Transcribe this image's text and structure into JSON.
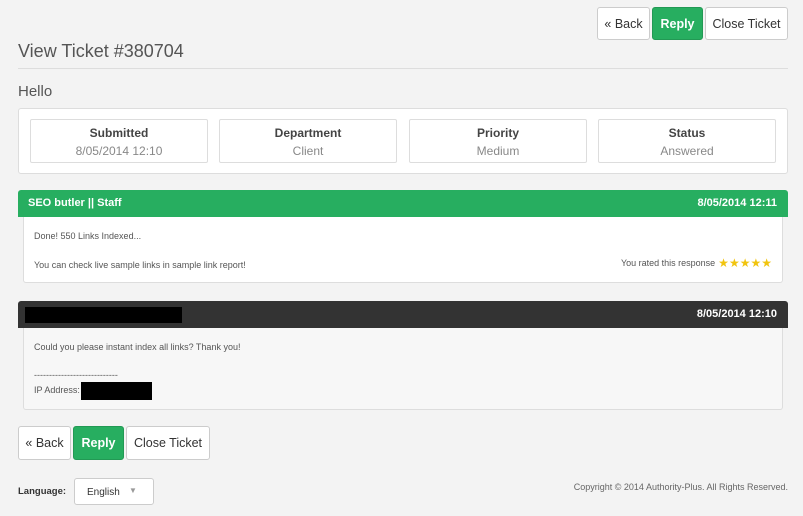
{
  "top_actions": {
    "back": "« Back",
    "reply": "Reply",
    "close": "Close Ticket"
  },
  "page": {
    "title": "View Ticket #380704",
    "subject": "Hello"
  },
  "info": [
    {
      "label": "Submitted",
      "value": "8/05/2014 12:10"
    },
    {
      "label": "Department",
      "value": "Client"
    },
    {
      "label": "Priority",
      "value": "Medium"
    },
    {
      "label": "Status",
      "value": "Answered"
    }
  ],
  "messages": [
    {
      "author": "SEO butler || Staff",
      "date": "8/05/2014 12:11",
      "line1": "Done! 550 Links Indexed...",
      "line2": "You can check live sample links in sample link report!",
      "rating_text": "You rated this response",
      "rating": 5,
      "header_color": "#27ae60"
    },
    {
      "author": "",
      "date": "8/05/2014 12:10",
      "line1": "Could you please instant index all links? Thank you!",
      "separator": "----------------------------",
      "ip_label": "IP Address:",
      "header_color": "#333333"
    }
  ],
  "bottom_actions": {
    "back": "« Back",
    "reply": "Reply",
    "close": "Close Ticket"
  },
  "footer": {
    "language_label": "Language:",
    "language_value": "English",
    "copyright": "Copyright © 2014 Authority-Plus. All Rights Reserved."
  }
}
